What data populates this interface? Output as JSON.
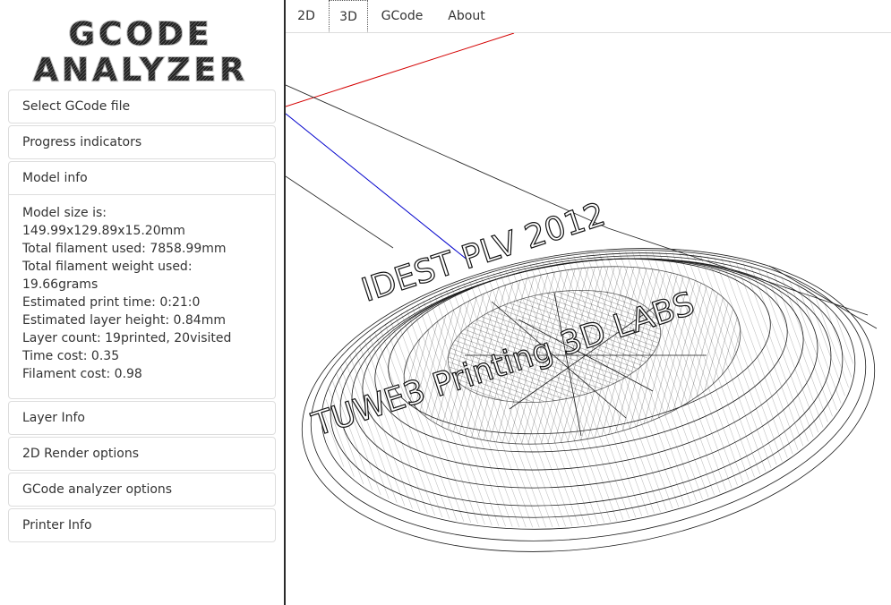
{
  "app": {
    "logo_line1": "GCODE",
    "logo_line2": "ANALYZER"
  },
  "sidebar": {
    "panels": [
      {
        "label": "Select GCode file"
      },
      {
        "label": "Progress indicators"
      },
      {
        "label": "Model info"
      },
      {
        "label": "Layer Info"
      },
      {
        "label": "2D Render options"
      },
      {
        "label": "GCode analyzer options"
      },
      {
        "label": "Printer Info"
      }
    ],
    "model_info": {
      "lines": [
        "Model size is:",
        "149.99x129.89x15.20mm",
        "Total filament used: 7858.99mm",
        "Total filament weight used:",
        "19.66grams",
        "Estimated print time: 0:21:0",
        "Estimated layer height: 0.84mm",
        "Layer count: 19printed, 20visited",
        "Time cost: 0.35",
        "Filament cost: 0.98"
      ]
    }
  },
  "tabs": [
    {
      "label": "2D"
    },
    {
      "label": "3D"
    },
    {
      "label": "GCode"
    },
    {
      "label": "About"
    }
  ],
  "viewport": {
    "model_text_1": "IDEST PLV 2012",
    "model_text_2": "TUWE3 Printing 3D LABS"
  },
  "colors": {
    "axis_x": "#d40000",
    "axis_y": "#0000cc",
    "model": "#1a1a1a"
  }
}
